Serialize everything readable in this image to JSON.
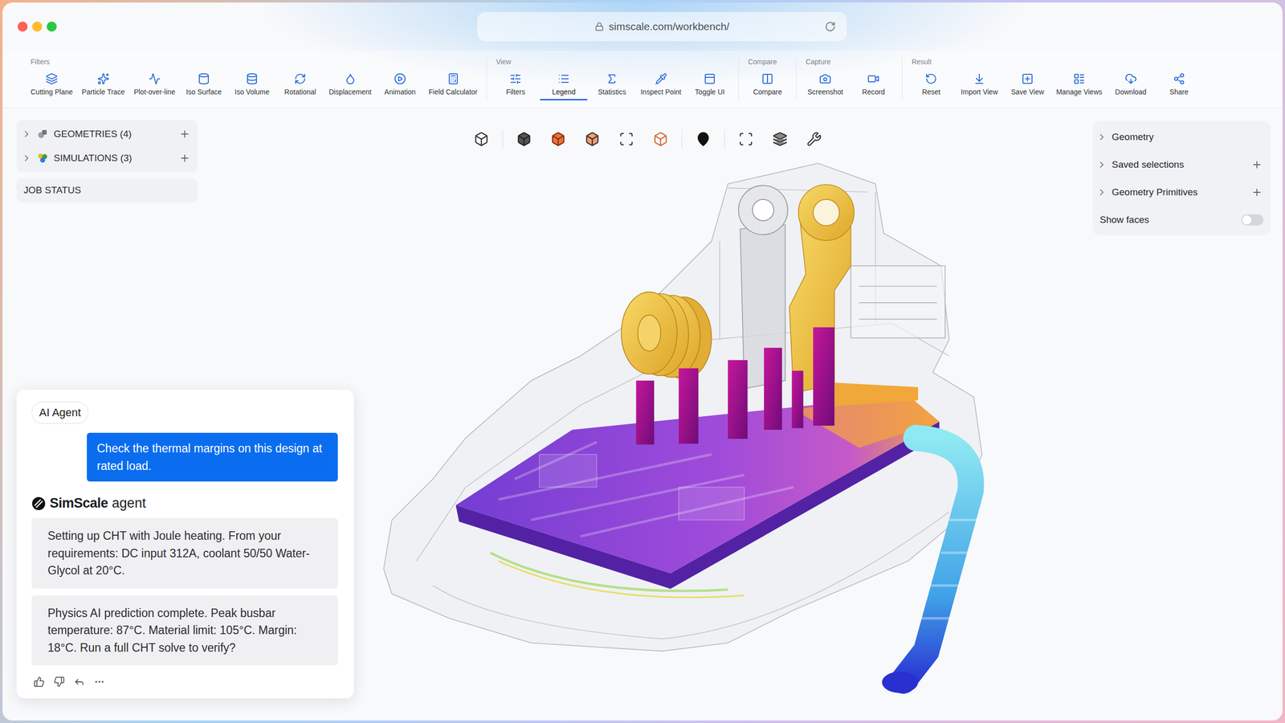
{
  "window": {
    "url": "simscale.com/workbench/"
  },
  "toolbar": {
    "groups": [
      {
        "label": "Filters",
        "items": [
          {
            "label": "Cutting Plane",
            "selected": false
          },
          {
            "label": "Particle Trace",
            "selected": false
          },
          {
            "label": "Plot-over-line",
            "selected": false
          },
          {
            "label": "Iso Surface",
            "selected": false
          },
          {
            "label": "Iso Volume",
            "selected": false
          },
          {
            "label": "Rotational",
            "selected": false
          },
          {
            "label": "Displacement",
            "selected": false
          },
          {
            "label": "Animation",
            "selected": false
          },
          {
            "label": "Field Calculator",
            "selected": false
          }
        ]
      },
      {
        "label": "View",
        "items": [
          {
            "label": "Filters",
            "selected": false
          },
          {
            "label": "Legend",
            "selected": true
          },
          {
            "label": "Statistics",
            "selected": false
          },
          {
            "label": "Inspect Point",
            "selected": false
          },
          {
            "label": "Toggle UI",
            "selected": false
          }
        ]
      },
      {
        "label": "Compare",
        "items": [
          {
            "label": "Compare",
            "selected": false
          }
        ]
      },
      {
        "label": "Capture",
        "items": [
          {
            "label": "Screenshot",
            "selected": false
          },
          {
            "label": "Record",
            "selected": false
          }
        ]
      },
      {
        "label": "Result",
        "items": [
          {
            "label": "Reset",
            "selected": false
          },
          {
            "label": "Import View",
            "selected": false
          },
          {
            "label": "Save View",
            "selected": false
          },
          {
            "label": "Manage Views",
            "selected": false
          },
          {
            "label": "Download",
            "selected": false
          },
          {
            "label": "Share",
            "selected": false
          }
        ]
      }
    ]
  },
  "sidebar": {
    "items": [
      {
        "label": "GEOMETRIES (4)",
        "expanded": false
      },
      {
        "label": "SIMULATIONS (3)",
        "expanded": false
      }
    ],
    "job_status": "JOB STATUS"
  },
  "right_panel": {
    "items": [
      {
        "label": "Geometry",
        "expanded": false,
        "addable": false
      },
      {
        "label": "Saved selections",
        "expanded": false,
        "addable": true
      },
      {
        "label": "Geometry Primitives",
        "expanded": false,
        "addable": true
      }
    ],
    "toggle": {
      "label": "Show faces",
      "on": false
    }
  },
  "chat": {
    "tag": "AI Agent",
    "user_message": "Check the thermal margins on this design at rated load.",
    "agent": {
      "brand": "SimScale",
      "suffix": "agent"
    },
    "messages": [
      "Setting up CHT with Joule heating. From your requirements: DC input 312A, coolant 50/50 Water-Glycol at 20°C.",
      "Physics AI prediction complete. Peak busbar temperature: 87°C. Material limit: 105°C. Margin: 18°C. Run a full CHT solve to verify?"
    ]
  }
}
